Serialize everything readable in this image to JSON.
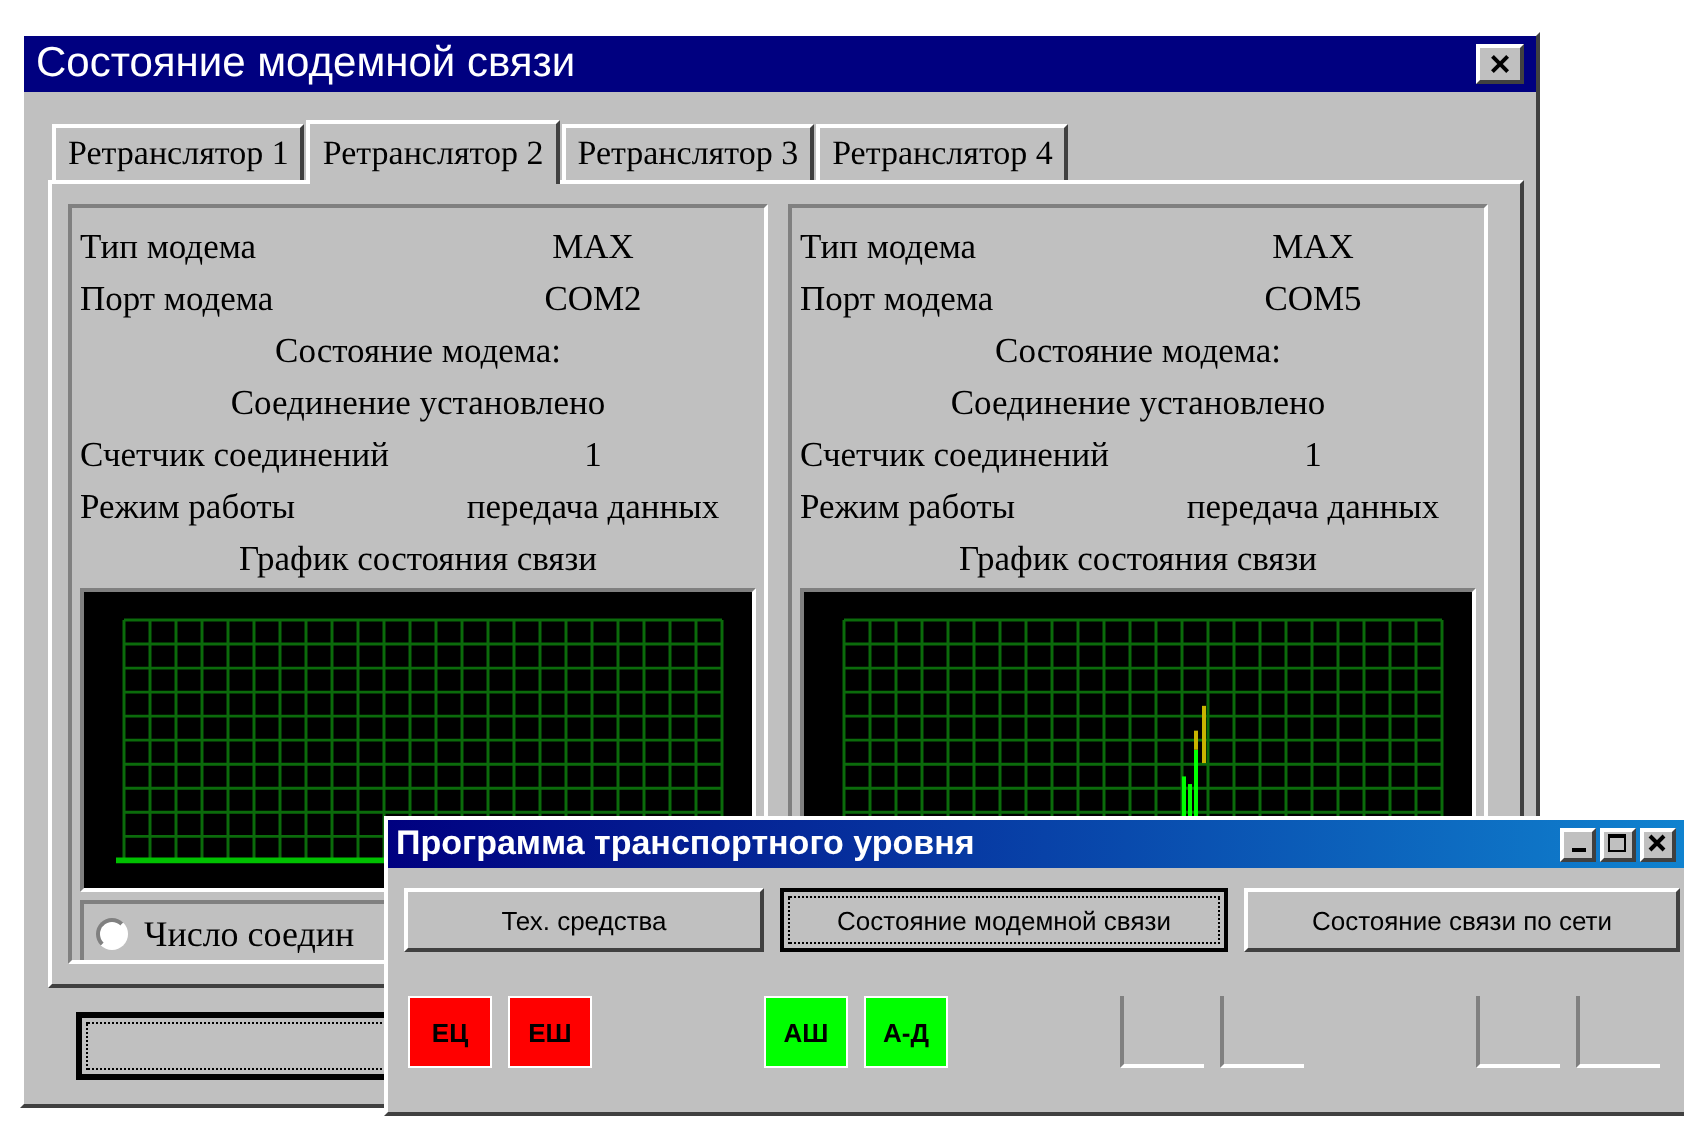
{
  "window": {
    "title": "Состояние модемной связи",
    "close": "×"
  },
  "tabs": [
    {
      "label": "Ретранслятор 1",
      "selected": false
    },
    {
      "label": "Ретранслятор 2",
      "selected": true
    },
    {
      "label": "Ретранслятор 3",
      "selected": false
    },
    {
      "label": "Ретранслятор 4",
      "selected": false
    }
  ],
  "panels": [
    {
      "rows": [
        {
          "kind": "pair",
          "label": "Тип модема",
          "value": "MAX"
        },
        {
          "kind": "pair",
          "label": "Порт модема",
          "value": "COM2"
        },
        {
          "kind": "center",
          "label": "Состояние модема:"
        },
        {
          "kind": "center",
          "label": "Соединение установлено"
        },
        {
          "kind": "pair",
          "label": "Счетчик соединений",
          "value": "1"
        },
        {
          "kind": "pair",
          "label": "Режим работы",
          "value": "передача данных"
        },
        {
          "kind": "center",
          "label": "График состояния связи"
        }
      ],
      "chart": {
        "kind": "empty"
      },
      "radio": {
        "label": "Число соедин",
        "selected": false
      }
    },
    {
      "rows": [
        {
          "kind": "pair",
          "label": "Тип модема",
          "value": "MAX"
        },
        {
          "kind": "pair",
          "label": "Порт модема",
          "value": "COM5"
        },
        {
          "kind": "center",
          "label": "Состояние модема:"
        },
        {
          "kind": "center",
          "label": "Соединение установлено"
        },
        {
          "kind": "pair",
          "label": "Счетчик соединений",
          "value": "1"
        },
        {
          "kind": "pair",
          "label": "Режим работы",
          "value": "передача данных"
        },
        {
          "kind": "center",
          "label": "График состояния связи"
        }
      ],
      "chart": {
        "kind": "bars"
      }
    }
  ],
  "transport": {
    "title": "Программа транспортного уровня",
    "buttons": [
      {
        "label": "Тех. средства",
        "selected": false
      },
      {
        "label": "Состояние модемной связи",
        "selected": true
      },
      {
        "label": "Состояние связи по сети",
        "selected": false
      }
    ],
    "indicators": [
      {
        "kind": "lit",
        "label": "ЕЦ",
        "color": "#ff0000"
      },
      {
        "kind": "lit",
        "label": "ЕШ",
        "color": "#ff0000"
      },
      {
        "kind": "gap"
      },
      {
        "kind": "lit",
        "label": "АШ",
        "color": "#00ff00"
      },
      {
        "kind": "lit",
        "label": "А-Д",
        "color": "#00ff00"
      },
      {
        "kind": "gap"
      },
      {
        "kind": "empty"
      },
      {
        "kind": "empty"
      },
      {
        "kind": "gap"
      },
      {
        "kind": "empty"
      },
      {
        "kind": "empty"
      }
    ]
  }
}
